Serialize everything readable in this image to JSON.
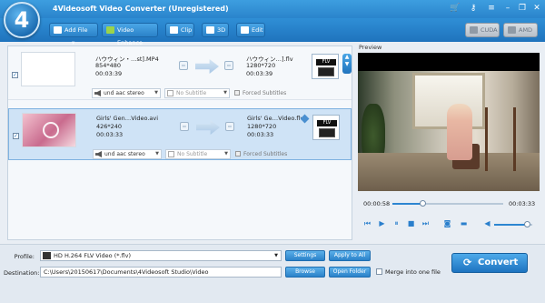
{
  "app": {
    "logo_text": "4",
    "title": "4Videosoft Video Converter (Unregistered)"
  },
  "window_controls": [
    "cart-icon",
    "key-icon",
    "menu-icon",
    "minimize-icon",
    "restore-icon",
    "close-icon"
  ],
  "toolbar": {
    "add_file": "Add File",
    "add_file_caret": "▾",
    "video_enhance": "Video Enhance",
    "clip": "Clip",
    "three_d": "3D",
    "edit": "Edit",
    "cuda": "CUDA",
    "amd": "AMD"
  },
  "files": [
    {
      "source_name": "ハウウィン・…st].MP4",
      "source_resolution": "854*480",
      "source_duration": "00:03:39",
      "target_name": "ハウウィン…].flv",
      "target_resolution": "1280*720",
      "target_duration": "00:03:39",
      "audio": "und aac stereo",
      "subtitle": "No Subtitle",
      "forced_subtitles": "Forced Subtitles",
      "format_label": "FLV",
      "checked": true,
      "selected": false
    },
    {
      "source_name": "Girls' Gen…Video.avi",
      "source_resolution": "426*240",
      "source_duration": "00:03:33",
      "target_name": "Girls' Ge…Video.flv",
      "target_resolution": "1280*720",
      "target_duration": "00:03:33",
      "audio": "und aac stereo",
      "subtitle": "No Subtitle",
      "forced_subtitles": "Forced Subtitles",
      "format_label": "FLV",
      "checked": true,
      "selected": true
    }
  ],
  "preview": {
    "label": "Preview",
    "current_time": "00:00:58",
    "total_time": "00:03:33",
    "progress": 0.27,
    "volume": 0.85
  },
  "settings": {
    "profile_label": "Profile:",
    "profile_value": "HD H.264 FLV Video (*.flv)",
    "settings_btn": "Settings",
    "apply_all_btn": "Apply to All",
    "destination_label": "Destination:",
    "destination_value": "C:\\Users\\20150617\\Documents\\4Videosoft Studio\\Video",
    "browse_btn": "Browse",
    "open_folder_btn": "Open Folder",
    "merge_label": "Merge into one file",
    "convert_btn": "Convert"
  }
}
